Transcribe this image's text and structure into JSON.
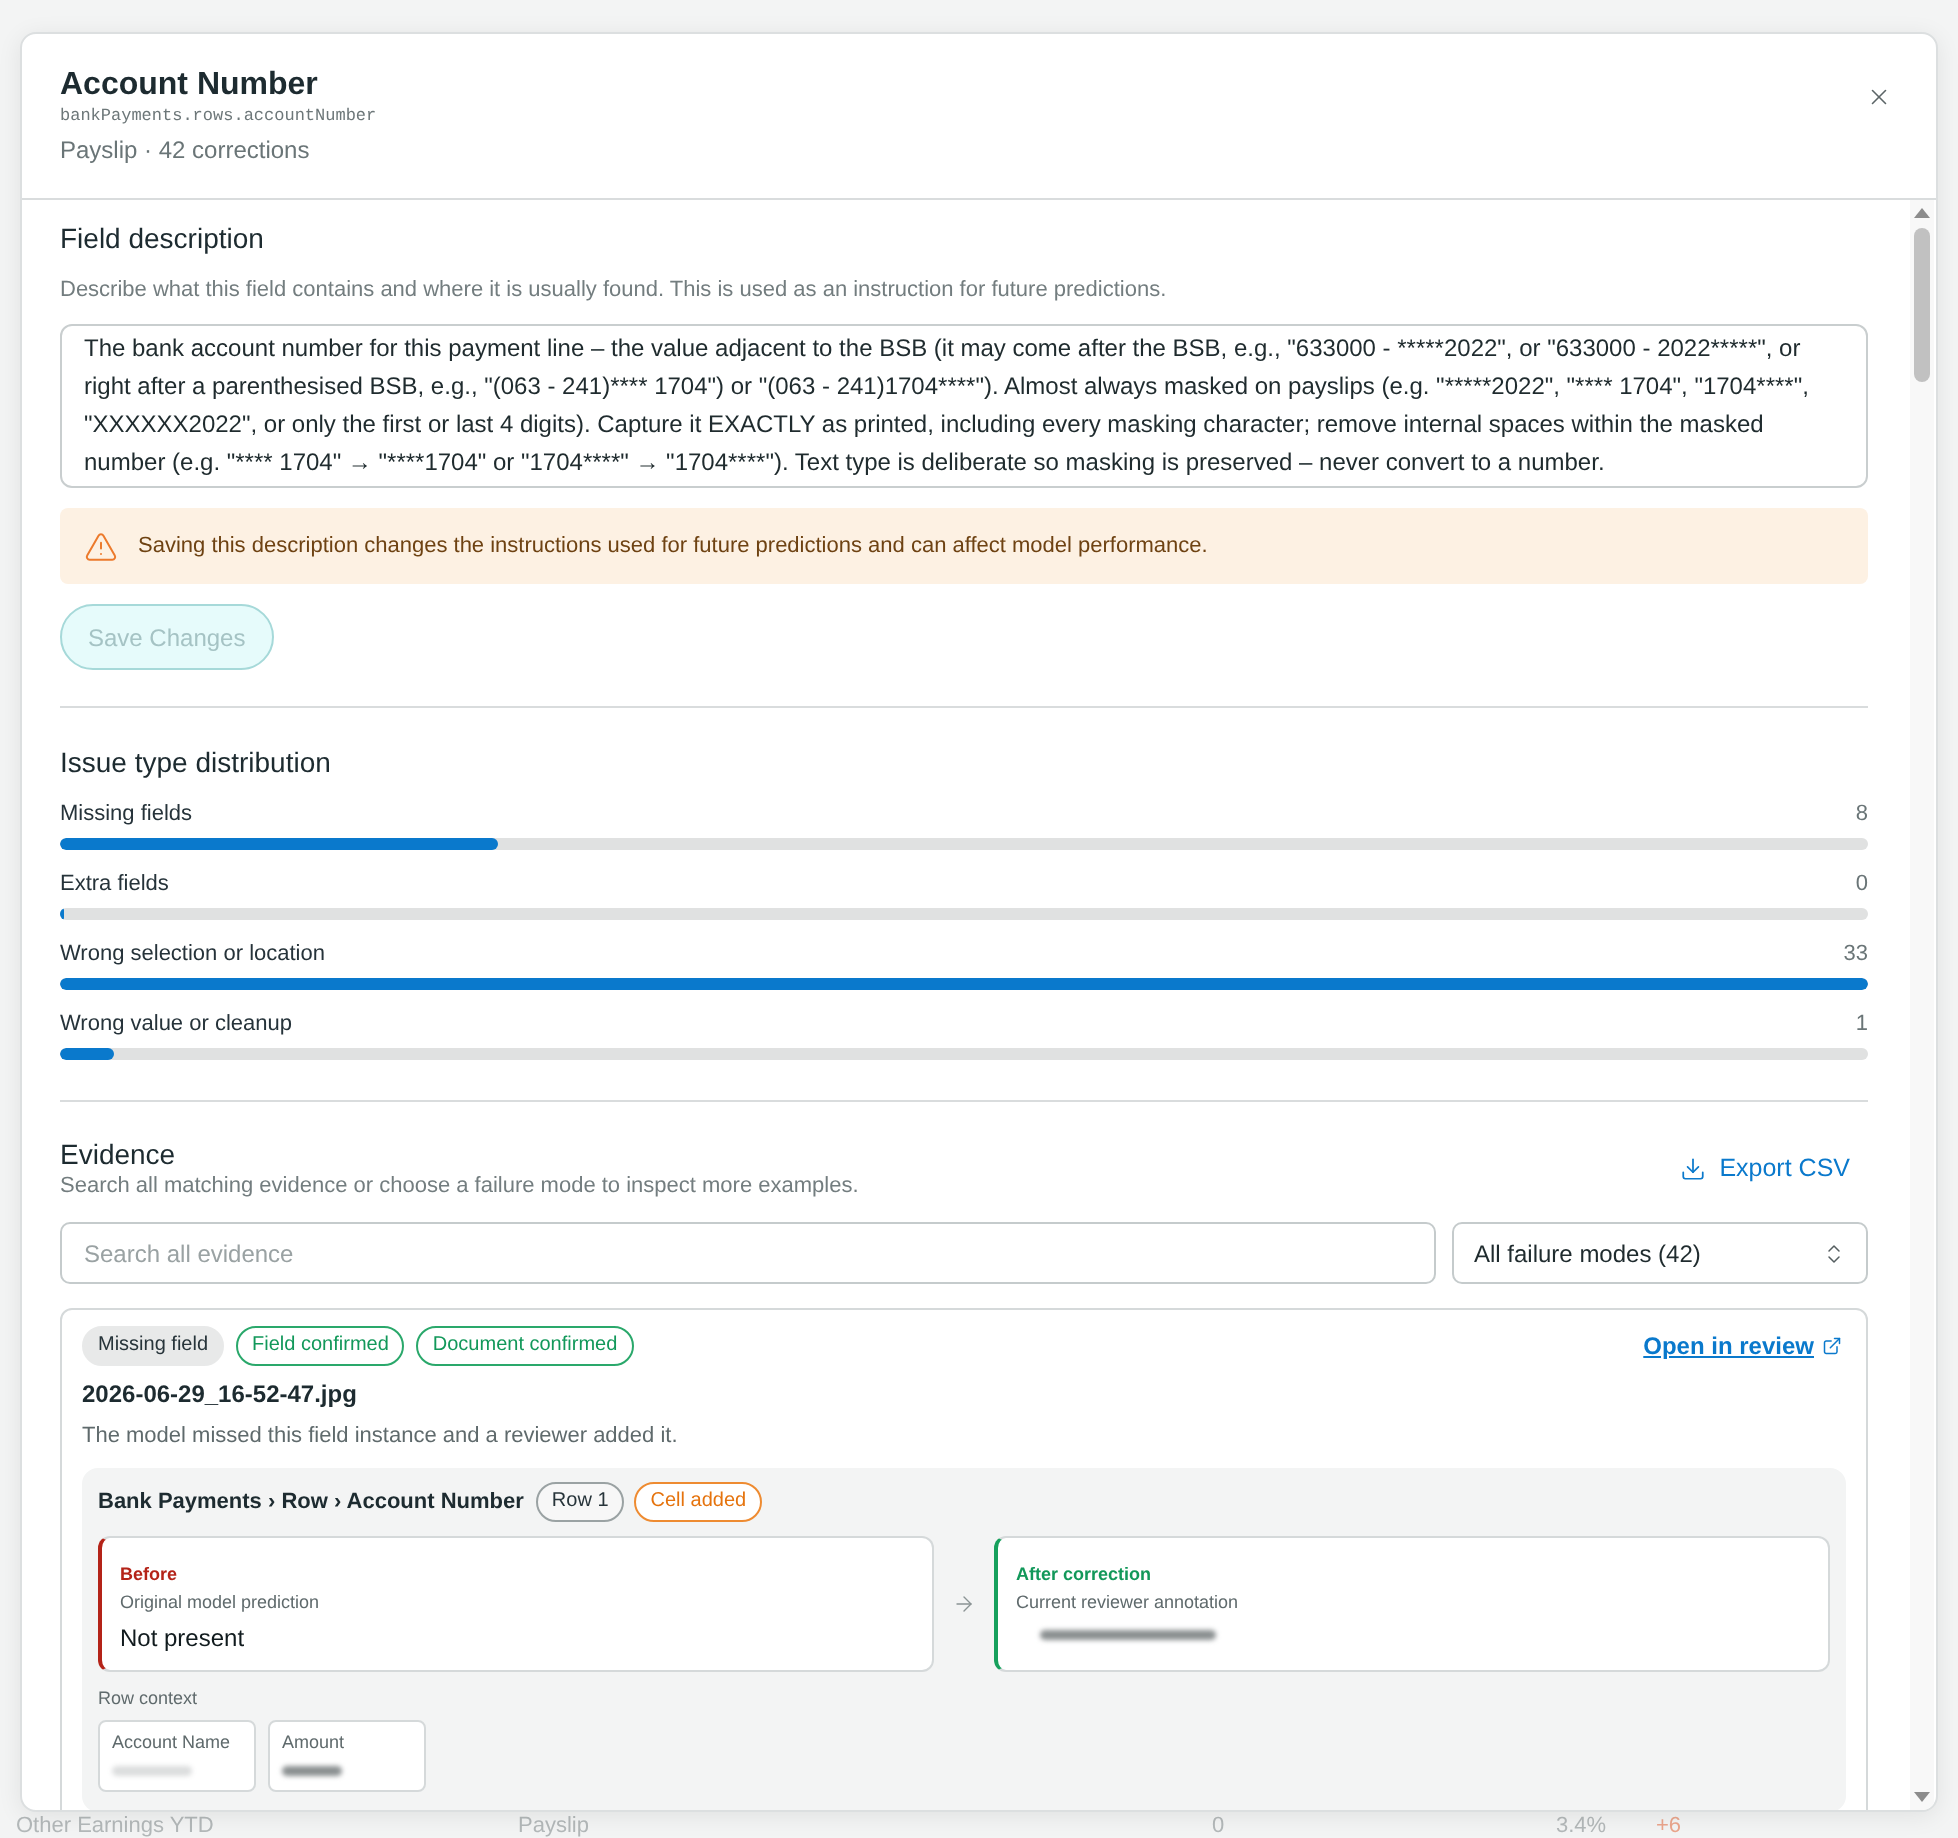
{
  "background_row": {
    "cells": [
      "Other Earnings YTD",
      "Payslip",
      "0",
      "3.4%",
      "+6"
    ]
  },
  "dialog": {
    "title": "Account Number",
    "path": "bankPayments.rows.accountNumber",
    "subtitle": "Payslip · 42 corrections"
  },
  "field_description": {
    "heading": "Field description",
    "hint": "Describe what this field contains and where it is usually found. This is used as an instruction for future predictions.",
    "value": "The bank account number for this payment line – the value adjacent to the BSB (it may come after the BSB, e.g., \"633000 - *****2022\", or \"633000 - 2022*****\", or right after a parenthesised BSB, e.g., \"(063 - 241)**** 1704\") or \"(063 - 241)1704****\"). Almost always masked on payslips (e.g. \"*****2022\", \"**** 1704\", \"1704****\", \"XXXXXX2022\", or only the first or last 4 digits). Capture it EXACTLY as printed, including every masking character; remove internal spaces within the masked number (e.g. \"**** 1704\" → \"****1704\" or \"1704****\" → \"1704****\"). Text type is deliberate so masking is preserved – never convert to a number.",
    "warning": "Saving this description changes the instructions used for future predictions and can affect model performance.",
    "save_button": {
      "label": "Save Changes",
      "disabled": true
    }
  },
  "issue_distribution": {
    "heading": "Issue type distribution",
    "items": [
      {
        "label": "Missing fields",
        "count": "8",
        "level": 0.242
      },
      {
        "label": "Extra fields",
        "count": "0",
        "level": 0
      },
      {
        "label": "Wrong selection or location",
        "count": "33",
        "level": 1
      },
      {
        "label": "Wrong value or cleanup",
        "count": "1",
        "level": 0.03
      }
    ]
  },
  "evidence": {
    "heading": "Evidence",
    "hint": "Search all matching evidence or choose a failure mode to inspect more examples.",
    "export_button": "Export CSV",
    "search": {
      "placeholder": "Search all evidence"
    },
    "filter": {
      "value": "All failure modes (42)"
    },
    "cards": [
      {
        "tags": [
          {
            "label": "Missing field",
            "kind": "type"
          },
          {
            "label": "Field confirmed",
            "kind": "success"
          },
          {
            "label": "Document confirmed",
            "kind": "success"
          }
        ],
        "link": "Open in review",
        "filename": "2026-06-29_16-52-47.jpg",
        "summary": "The model missed this field instance and a reviewer added it.",
        "detail": {
          "path": "Bank Payments › Row › Account Number",
          "tags": [
            {
              "label": "Row 1",
              "kind": "neutral"
            },
            {
              "label": "Cell added",
              "kind": "warning"
            }
          ],
          "before": {
            "label": "Before",
            "caption": "Original model prediction",
            "value": "Not present"
          },
          "after": {
            "label": "After correction",
            "caption": "Current reviewer annotation",
            "redacted": true
          },
          "row_context": {
            "label": "Row context",
            "fields": [
              {
                "label": "Account Name",
                "redacted": true
              },
              {
                "label": "Amount",
                "redacted": true
              }
            ]
          }
        }
      }
    ]
  }
}
